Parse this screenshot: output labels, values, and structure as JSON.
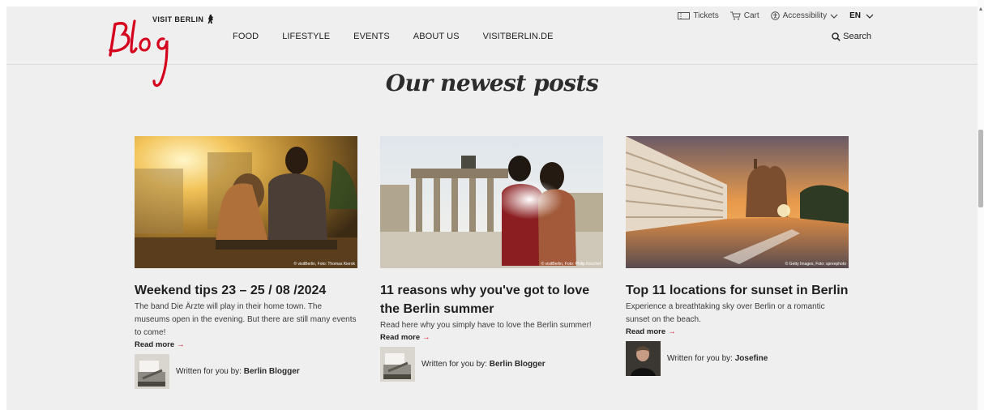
{
  "brand": {
    "visit_label": "VISIT BERLIN",
    "blog_label": "Blog",
    "accent": "#d5001c"
  },
  "nav": {
    "items": [
      {
        "label": "FOOD"
      },
      {
        "label": "LIFESTYLE"
      },
      {
        "label": "EVENTS"
      },
      {
        "label": "ABOUT US"
      },
      {
        "label": "VISITBERLIN.DE"
      }
    ]
  },
  "utilities": {
    "tickets": "Tickets",
    "cart": "Cart",
    "accessibility": "Accessibility",
    "language": "EN",
    "search": "Search"
  },
  "section_title": "Our newest posts",
  "posts": [
    {
      "title": "Weekend tips 23 – 25 / 08 /2024",
      "excerpt": "The band Die Ärzte will play in their home town. The museums open in the evening. But there are still many events to come!",
      "read_more": "Read more",
      "credit": "© visitBerlin, Foto: Thomas Kierok",
      "author_prefix": "Written for you by:",
      "author": "Berlin Blogger",
      "image_icon": "couple-sunset-photo",
      "avatar_icon": "typewriter-avatar"
    },
    {
      "title": "11 reasons why you've got to love the Berlin summer",
      "excerpt": "Read here why you simply have to love the Berlin summer!",
      "read_more": "Read more",
      "credit": "© visitBerlin, Foto: Philip Koschel",
      "author_prefix": "Written for you by:",
      "author": "Berlin Blogger",
      "image_icon": "brandenburg-gate-photo",
      "avatar_icon": "typewriter-avatar"
    },
    {
      "title": "Top 11 locations for sunset in Berlin",
      "excerpt": "Experience a breathtaking sky over Berlin or a romantic sunset on the beach.",
      "read_more": "Read more",
      "credit": "© Getty Images, Foto: spreephoto",
      "author_prefix": "Written for you by:",
      "author": "Josefine",
      "image_icon": "spree-sunset-photo",
      "avatar_icon": "person-avatar"
    }
  ]
}
